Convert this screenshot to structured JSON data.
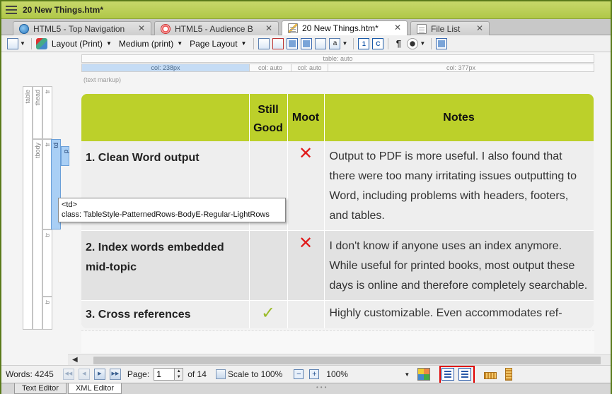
{
  "window": {
    "title": "20 New Things.htm*"
  },
  "tabs": [
    {
      "label": "HTML5 - Top Navigation",
      "icon": "globe-icon",
      "active": false
    },
    {
      "label": "HTML5 - Audience B",
      "icon": "target-icon",
      "active": false
    },
    {
      "label": "20 New Things.htm*",
      "icon": "document-edit-icon",
      "active": true
    },
    {
      "label": "File List",
      "icon": "document-icon",
      "active": false
    }
  ],
  "toolbar": {
    "layout": "Layout (Print)",
    "medium": "Medium (print)",
    "page_layout": "Page Layout"
  },
  "ruler": {
    "table": "table: auto",
    "cols": [
      "col: 238px",
      "col: auto",
      "col: auto",
      "col: 377px"
    ]
  },
  "markup_label": "(text markup)",
  "structure": {
    "table": "table",
    "thead": "thead",
    "tr": "tr",
    "tbody": "tbody",
    "td": "td",
    "p": "p"
  },
  "table": {
    "headers": [
      "",
      "Still Good",
      "Moot",
      "Notes"
    ],
    "rows": [
      {
        "item": "1. Clean Word output",
        "still_good": "",
        "moot": "✕",
        "note": "Output to PDF is more useful. I also found that there were too many irritating issues outputting to Word, including problems with headers, footers, and tables."
      },
      {
        "item": "2. Index words embedded mid-topic",
        "still_good": "",
        "moot": "✕",
        "note": "I don't know if anyone uses an index anymore. While useful for printed books, most output these days is online and therefore completely searchable."
      },
      {
        "item": "3. Cross references",
        "still_good": "✓",
        "moot": "",
        "note": "Highly customizable. Even accommodates ref-"
      }
    ]
  },
  "tooltip": {
    "tag": "<td>",
    "class_line": "class: TableStyle-PatternedRows-BodyE-Regular-LightRows"
  },
  "status": {
    "words": "Words: 4245",
    "page_label": "Page:",
    "page_value": "1",
    "of_pages": "of 14",
    "scale": "Scale to 100%",
    "zoom": "100%"
  },
  "bottom_tabs": [
    "Text Editor",
    "XML Editor"
  ]
}
